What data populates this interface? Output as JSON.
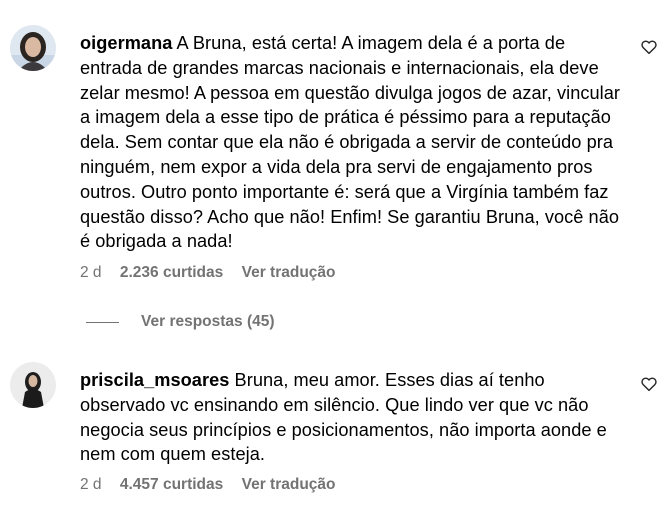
{
  "comments": [
    {
      "username": "oigermana",
      "text": "A Bruna, está certa! A imagem dela é a porta de entrada de grandes marcas nacionais e internacionais, ela deve zelar mesmo! A pessoa em questão divulga jogos de azar, vincular a imagem dela a esse tipo de prática é péssimo para a reputação dela. Sem contar que ela não é obrigada a servir de conteúdo pra ninguém, nem expor a vida dela pra servi de engajamento pros outros. Outro ponto importante é: será que a Virgínia também faz questão disso? Acho que não! Enfim! Se garantiu Bruna, você não é obrigada a nada!",
      "time": "2 d",
      "likes": "2.236 curtidas",
      "translate": "Ver tradução"
    },
    {
      "username": "priscila_msoares",
      "text": "Bruna, meu amor. Esses dias aí tenho observado vc ensinando em silêncio. Que lindo ver que vc não negocia seus princípios e posicionamentos, não importa aonde e nem com quem esteja.",
      "time": "2 d",
      "likes": "4.457 curtidas",
      "translate": "Ver tradução"
    }
  ],
  "replies": {
    "label": "Ver respostas (45)"
  },
  "icons": {
    "like": "heart-outline-icon"
  },
  "colors": {
    "meta": "#737373",
    "text": "#000000"
  }
}
